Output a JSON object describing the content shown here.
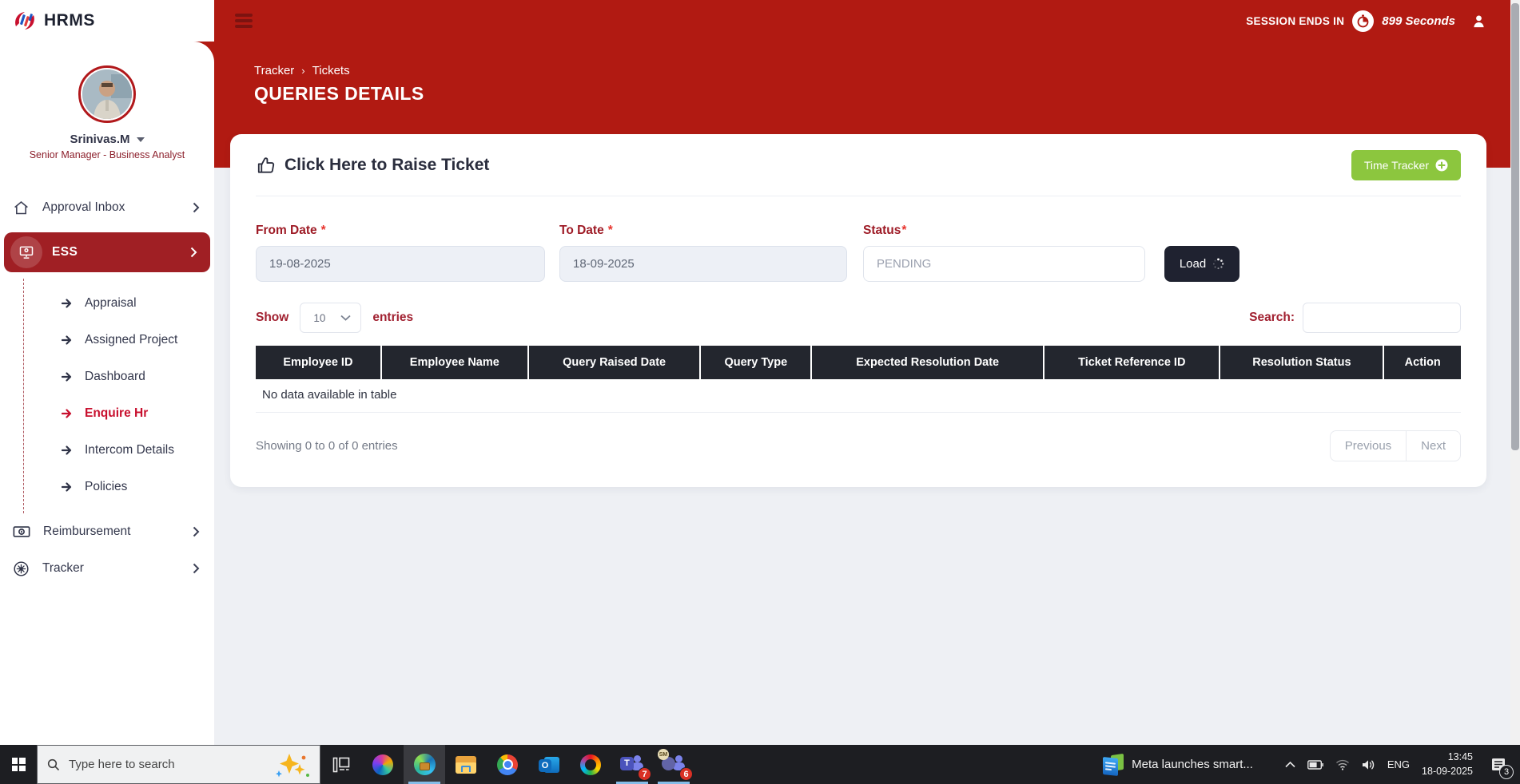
{
  "colors": {
    "brand_red": "#b11a12",
    "active_maroon": "#a01f24",
    "accent_green": "#8cc63e",
    "table_header_dark": "#23262e",
    "label_red": "#9e1b26",
    "active_link_red": "#c8102e",
    "page_bg": "#eef0f4"
  },
  "topbar": {
    "logo_text": "HRMS",
    "session_label": "SESSION ENDS IN",
    "session_value": "899 Seconds"
  },
  "sidebar": {
    "user": {
      "name": "Srinivas.M",
      "role": "Senior Manager - Business Analyst"
    },
    "items": [
      {
        "label": "Approval Inbox"
      },
      {
        "label": "ESS",
        "children": [
          {
            "label": "Appraisal"
          },
          {
            "label": "Assigned Project"
          },
          {
            "label": "Dashboard"
          },
          {
            "label": "Enquire Hr"
          },
          {
            "label": "Intercom Details"
          },
          {
            "label": "Policies"
          }
        ]
      },
      {
        "label": "Reimbursement"
      },
      {
        "label": "Tracker"
      }
    ]
  },
  "page": {
    "breadcrumb": [
      "Tracker",
      "Tickets"
    ],
    "breadcrumb_separator": "›",
    "title": "QUERIES DETAILS"
  },
  "card": {
    "heading": "Click Here to Raise Ticket",
    "time_tracker_button": "Time Tracker",
    "form": {
      "from_date": {
        "label": "From Date",
        "required": "*",
        "value": "19-08-2025"
      },
      "to_date": {
        "label": "To Date",
        "required": "*",
        "value": "18-09-2025"
      },
      "status": {
        "label": "Status",
        "required": "*",
        "placeholder": "PENDING"
      },
      "load_button": "Load"
    },
    "table_controls": {
      "show_label": "Show",
      "page_size": "10",
      "entries_label": "entries",
      "search_label": "Search:"
    },
    "table": {
      "headers": [
        "Employee ID",
        "Employee Name",
        "Query Raised Date",
        "Query Type",
        "Expected Resolution Date",
        "Ticket Reference ID",
        "Resolution Status",
        "Action"
      ],
      "empty_message": "No data available in table",
      "summary": "Showing 0 to 0 of 0 entries",
      "prev_button": "Previous",
      "next_button": "Next"
    }
  },
  "taskbar": {
    "search_placeholder": "Type here to search",
    "news_ticker": "Meta launches smart...",
    "language": "ENG",
    "time": "13:45",
    "date": "18-09-2025",
    "teams_badge": "7",
    "chat_badge": "6",
    "notification_badge": "3",
    "avatar_initials": "SM"
  }
}
